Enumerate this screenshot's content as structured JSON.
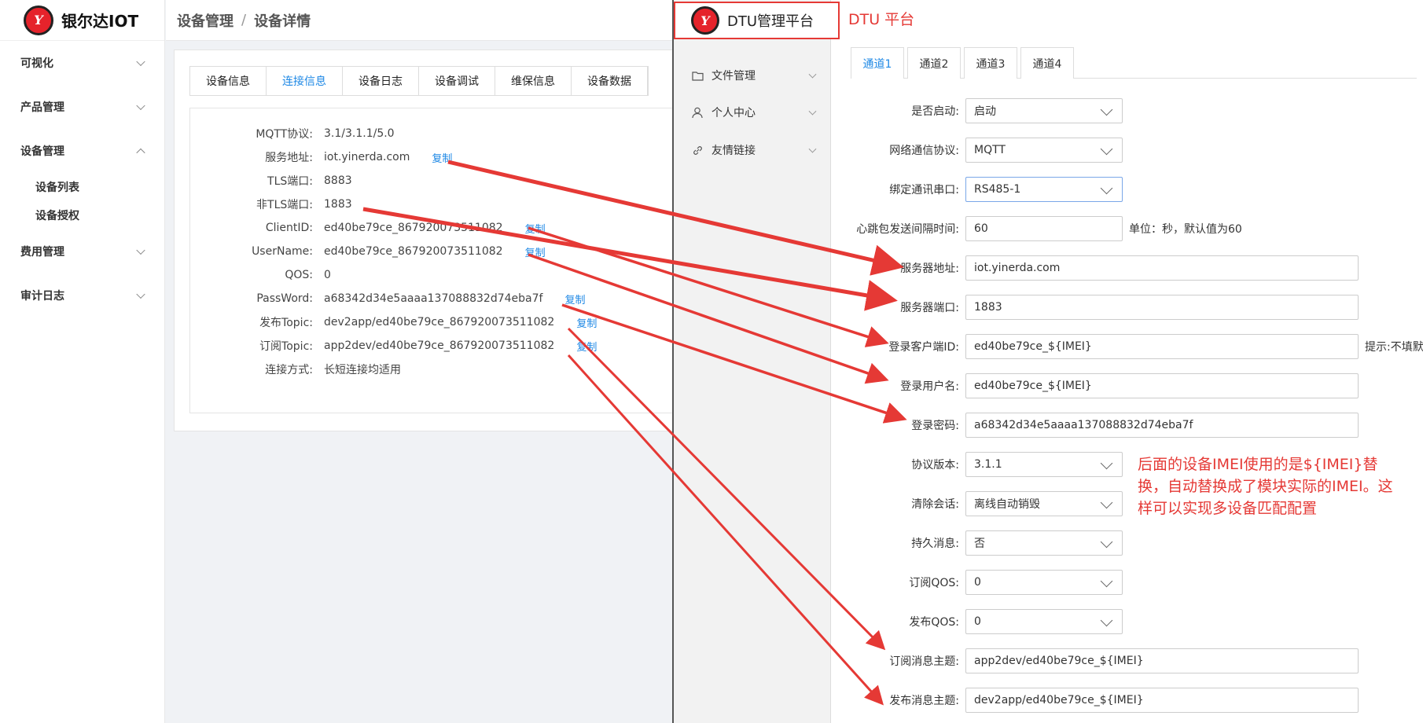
{
  "left_app": {
    "brand": "银尔达IOT",
    "logo_mark": "Y",
    "sidebar": {
      "visualize": "可视化",
      "product_mgmt": "产品管理",
      "device_mgmt": "设备管理",
      "device_list": "设备列表",
      "device_auth": "设备授权",
      "fee_mgmt": "费用管理",
      "audit_log": "审计日志"
    },
    "breadcrumb": {
      "parent": "设备管理",
      "separator": "/",
      "current": "设备详情"
    },
    "tabs": [
      "设备信息",
      "连接信息",
      "设备日志",
      "设备调试",
      "维保信息",
      "设备数据"
    ],
    "copy_label": "复制",
    "fields": [
      {
        "label": "MQTT协议:",
        "value": "3.1/3.1.1/5.0"
      },
      {
        "label": "服务地址:",
        "value": "iot.yinerda.com"
      },
      {
        "label": "TLS端口:",
        "value": "8883"
      },
      {
        "label": "非TLS端口:",
        "value": "1883"
      },
      {
        "label": "ClientID:",
        "value": "ed40be79ce_867920073511082"
      },
      {
        "label": "UserName:",
        "value": "ed40be79ce_867920073511082"
      },
      {
        "label": "QOS:",
        "value": "0"
      },
      {
        "label": "PassWord:",
        "value": "a68342d34e5aaaa137088832d74eba7f"
      },
      {
        "label": "发布Topic:",
        "value": "dev2app/ed40be79ce_867920073511082"
      },
      {
        "label": "订阅Topic:",
        "value": "app2dev/ed40be79ce_867920073511082"
      },
      {
        "label": "连接方式:",
        "value": "长短连接均适用"
      }
    ]
  },
  "right_app": {
    "brand": "DTU管理平台",
    "logo_mark": "Y",
    "annotation_title": "DTU 平台",
    "sidebar": {
      "file_mgmt": "文件管理",
      "personal": "个人中心",
      "links": "友情链接"
    },
    "tabs": [
      "通道1",
      "通道2",
      "通道3",
      "通道4"
    ],
    "form": {
      "enabled": {
        "label": "是否启动:",
        "value": "启动"
      },
      "protocol": {
        "label": "网络通信协议:",
        "value": "MQTT"
      },
      "serial": {
        "label": "绑定通讯串口:",
        "value": "RS485-1"
      },
      "heartbeat": {
        "label": "心跳包发送间隔时间:",
        "value": "60",
        "hint": "单位：秒，默认值为60"
      },
      "server_addr": {
        "label": "服务器地址:",
        "value": "iot.yinerda.com"
      },
      "server_port": {
        "label": "服务器端口:",
        "value": "1883"
      },
      "client_id": {
        "label": "登录客户端ID:",
        "value": "ed40be79ce_${IMEI}",
        "hint": "提示:不填默"
      },
      "username": {
        "label": "登录用户名:",
        "value": "ed40be79ce_${IMEI}"
      },
      "password": {
        "label": "登录密码:",
        "value": "a68342d34e5aaaa137088832d74eba7f"
      },
      "proto_version": {
        "label": "协议版本:",
        "value": "3.1.1"
      },
      "clean_session": {
        "label": "清除会话:",
        "value": "离线自动销毁"
      },
      "retain": {
        "label": "持久消息:",
        "value": "否"
      },
      "sub_qos": {
        "label": "订阅QOS:",
        "value": "0"
      },
      "pub_qos": {
        "label": "发布QOS:",
        "value": "0"
      },
      "sub_topic": {
        "label": "订阅消息主题:",
        "value": "app2dev/ed40be79ce_${IMEI}"
      },
      "pub_topic": {
        "label": "发布消息主题:",
        "value": "dev2app/ed40be79ce_${IMEI}"
      }
    },
    "note": "后面的设备IMEI使用的是${IMEI}替换，自动替换成了模块实际的IMEI。这样可以实现多设备匹配配置"
  },
  "colors": {
    "annotation_red": "#e53935",
    "link_blue": "#1e88e5",
    "logo_red": "#e5232b"
  }
}
